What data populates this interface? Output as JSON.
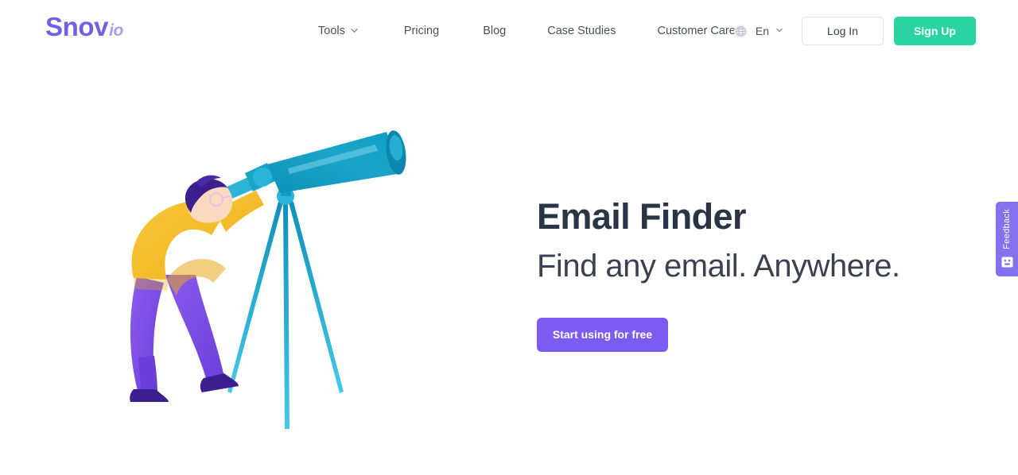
{
  "header": {
    "logo": {
      "primary": "Snov",
      "suffix": "io",
      "name": "Snov.io"
    },
    "nav": [
      {
        "label": "Tools",
        "has_dropdown": true,
        "icon": "chevron-down-icon"
      },
      {
        "label": "Pricing",
        "has_dropdown": false
      },
      {
        "label": "Blog",
        "has_dropdown": false
      },
      {
        "label": "Case Studies",
        "has_dropdown": false
      },
      {
        "label": "Customer Care",
        "has_dropdown": false
      }
    ],
    "language": {
      "label": "En",
      "icon": "globe-icon",
      "chevron": "chevron-down-icon"
    },
    "login_label": "Log In",
    "signup_label": "Sign Up"
  },
  "hero": {
    "title": "Email Finder",
    "subtitle": "Find any email. Anywhere.",
    "cta_label": "Start using for free",
    "illustration": "man-looking-through-telescope-illustration"
  },
  "feedback": {
    "label": "Feedback",
    "icon": "smiley-face-icon"
  },
  "colors": {
    "logo_primary": "#7060e8",
    "logo_suffix": "#a79df0",
    "signup_green": "#2ad3a2",
    "cta_purple": "#7c5cf0",
    "feedback_purple": "#8371ee",
    "heading_navy": "#2b3445",
    "nav_text": "#4a4f58",
    "page_background": "#ffffff",
    "illustration_teal": "#0f9fc4",
    "illustration_cyan": "#29b6dd",
    "illustration_yellow": "#f5bf2a",
    "illustration_purple": "#7b4fe0",
    "illustration_dark_purple": "#3c1f8f",
    "illustration_skin": "#fbd9c0"
  }
}
